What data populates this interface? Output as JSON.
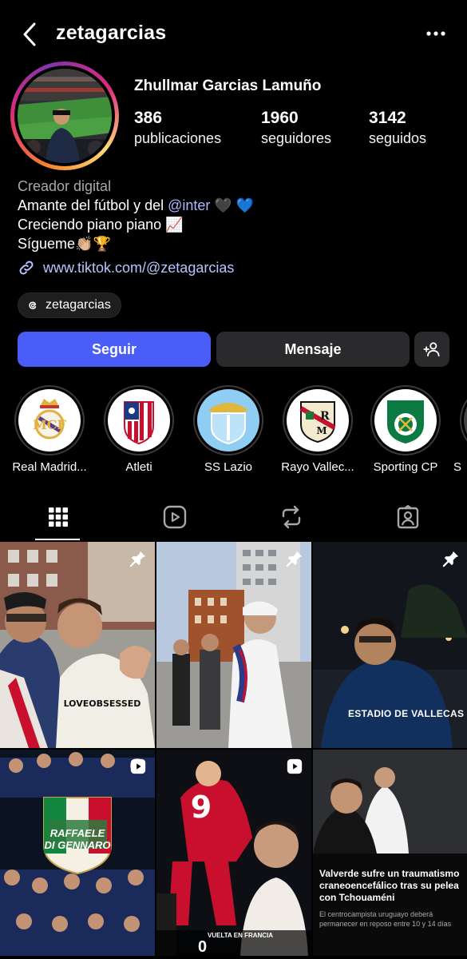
{
  "header": {
    "username": "zetagarcias",
    "back_icon": "chevron-left-icon",
    "more_icon": "ellipsis-icon"
  },
  "profile": {
    "full_name": "Zhullmar Garcias Lamuño",
    "stats": [
      {
        "value": "386",
        "label": "publicaciones"
      },
      {
        "value": "1960",
        "label": "seguidores"
      },
      {
        "value": "3142",
        "label": "seguidos"
      }
    ],
    "category": "Creador digital",
    "bio_line1_prefix": "Amante del fútbol y del ",
    "bio_line1_mention": "@inter",
    "bio_line1_suffix": " 🖤 💙",
    "bio_line2": "Creciendo piano piano 📈",
    "bio_line3": "Sígueme👏🏼🏆",
    "link": "www.tiktok.com/@zetagarcias",
    "threads_handle": "zetagarcias"
  },
  "actions": {
    "follow_label": "Seguir",
    "message_label": "Mensaje",
    "suggest_icon": "add-person-icon"
  },
  "highlights": [
    {
      "label": "Real Madrid..."
    },
    {
      "label": "Atleti"
    },
    {
      "label": "SS Lazio"
    },
    {
      "label": "Rayo Vallec..."
    },
    {
      "label": "Sporting CP"
    },
    {
      "label": "S"
    }
  ],
  "tabs": [
    {
      "name": "posts",
      "icon": "grid-icon",
      "active": true
    },
    {
      "name": "reels",
      "icon": "reels-icon",
      "active": false
    },
    {
      "name": "reposts",
      "icon": "repost-icon",
      "active": false
    },
    {
      "name": "tagged",
      "icon": "tagged-icon",
      "active": false
    }
  ],
  "grid": {
    "post3_caption": "ESTADIO DE VALLECAS",
    "post4_caption_line1": "RAFFAELE",
    "post4_caption_line2": "DI GENNARO",
    "post6_headline": "Valverde sufre un traumatismo craneoencefálico tras su pelea con Tchouaméni",
    "post6_subtext": "El centrocampista uruguayo deberá permanecer en reposo entre 10 y 14 días",
    "post2_shirt_text": "LOVEOBSESSED",
    "post5_shirt_number": "9",
    "post5_score_label": "VUELTA EN FRANCIA",
    "post5_score": "0"
  },
  "colors": {
    "follow_button": "#4a5df9",
    "secondary_button": "#2a2a2d",
    "link": "#b8c4ff",
    "category": "#a8a8a8"
  }
}
